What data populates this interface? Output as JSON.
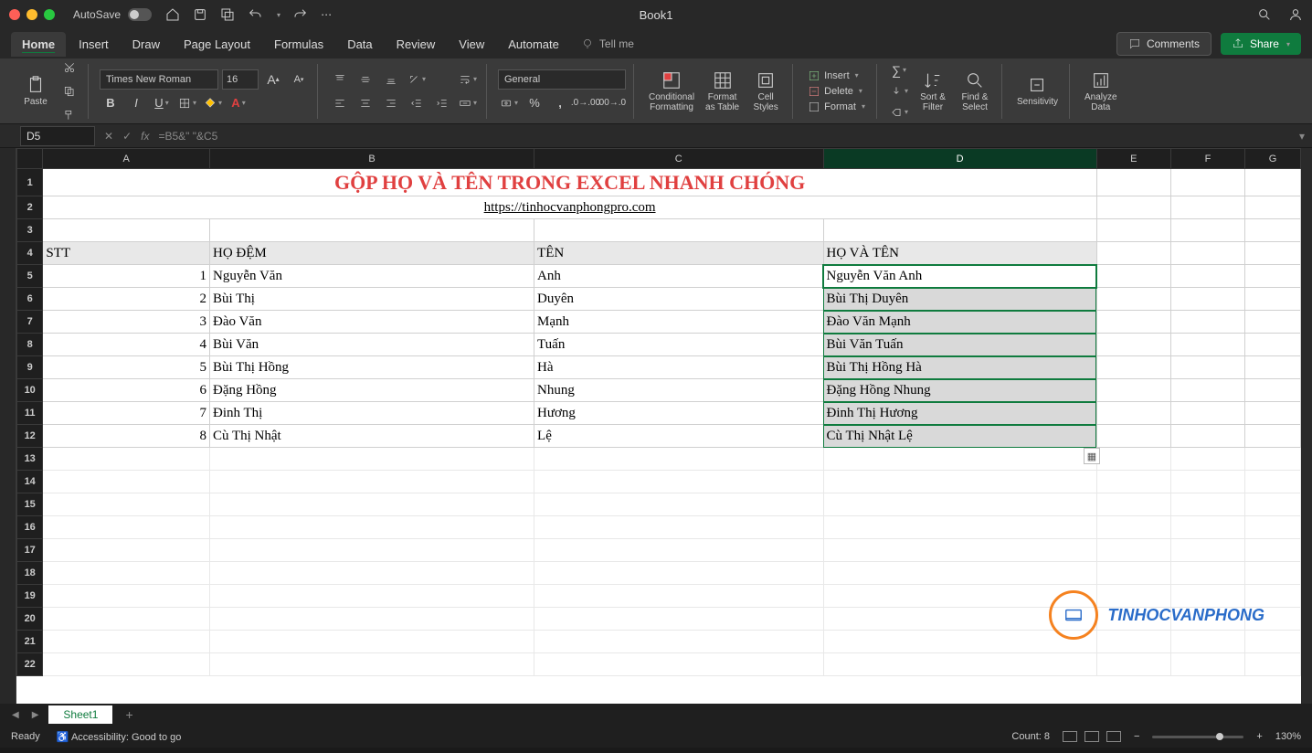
{
  "window": {
    "autosave": "AutoSave",
    "title": "Book1"
  },
  "tabs": {
    "items": [
      "Home",
      "Insert",
      "Draw",
      "Page Layout",
      "Formulas",
      "Data",
      "Review",
      "View",
      "Automate"
    ],
    "active": "Home",
    "tellme": "Tell me",
    "comments": "Comments",
    "share": "Share"
  },
  "ribbon": {
    "paste": "Paste",
    "font_name": "Times New Roman",
    "font_size": "16",
    "number_format": "General",
    "cond_fmt": "Conditional\nFormatting",
    "fmt_table": "Format\nas Table",
    "cell_styles": "Cell\nStyles",
    "insert": "Insert",
    "delete": "Delete",
    "format": "Format",
    "sort": "Sort &\nFilter",
    "find": "Find &\nSelect",
    "sensitivity": "Sensitivity",
    "analyze": "Analyze\nData"
  },
  "formula_bar": {
    "name_box": "D5",
    "formula": "=B5&\" \"&C5"
  },
  "sheet": {
    "columns": [
      "A",
      "B",
      "C",
      "D",
      "E",
      "F",
      "G"
    ],
    "title": "GỘP HỌ VÀ TÊN TRONG EXCEL NHANH CHÓNG",
    "link": "https://tinhocvanphongpro.com",
    "headers": {
      "stt": "STT",
      "ho_dem": "HỌ ĐỆM",
      "ten": "TÊN",
      "ho_va_ten": "HỌ VÀ TÊN"
    },
    "rows": [
      {
        "stt": "1",
        "ho_dem": "Nguyễn Văn",
        "ten": "Anh",
        "full": "Nguyễn Văn Anh"
      },
      {
        "stt": "2",
        "ho_dem": "Bùi Thị",
        "ten": "Duyên",
        "full": "Bùi Thị Duyên"
      },
      {
        "stt": "3",
        "ho_dem": "Đào Văn",
        "ten": "Mạnh",
        "full": "Đào Văn Mạnh"
      },
      {
        "stt": "4",
        "ho_dem": "Bùi Văn",
        "ten": "Tuấn",
        "full": "Bùi Văn Tuấn"
      },
      {
        "stt": "5",
        "ho_dem": "Bùi Thị Hồng",
        "ten": "Hà",
        "full": "Bùi Thị Hồng Hà"
      },
      {
        "stt": "6",
        "ho_dem": "Đặng Hồng",
        "ten": "Nhung",
        "full": "Đặng Hồng Nhung"
      },
      {
        "stt": "7",
        "ho_dem": "Đinh Thị",
        "ten": "Hương",
        "full": "Đinh Thị Hương"
      },
      {
        "stt": "8",
        "ho_dem": "Cù Thị Nhật",
        "ten": "Lệ",
        "full": "Cù Thị Nhật Lệ"
      }
    ]
  },
  "sheet_tabs": {
    "active": "Sheet1"
  },
  "status": {
    "ready": "Ready",
    "accessibility": "Accessibility: Good to go",
    "count": "Count: 8",
    "zoom": "130%"
  },
  "watermark": "TINHOCVANPHONG"
}
